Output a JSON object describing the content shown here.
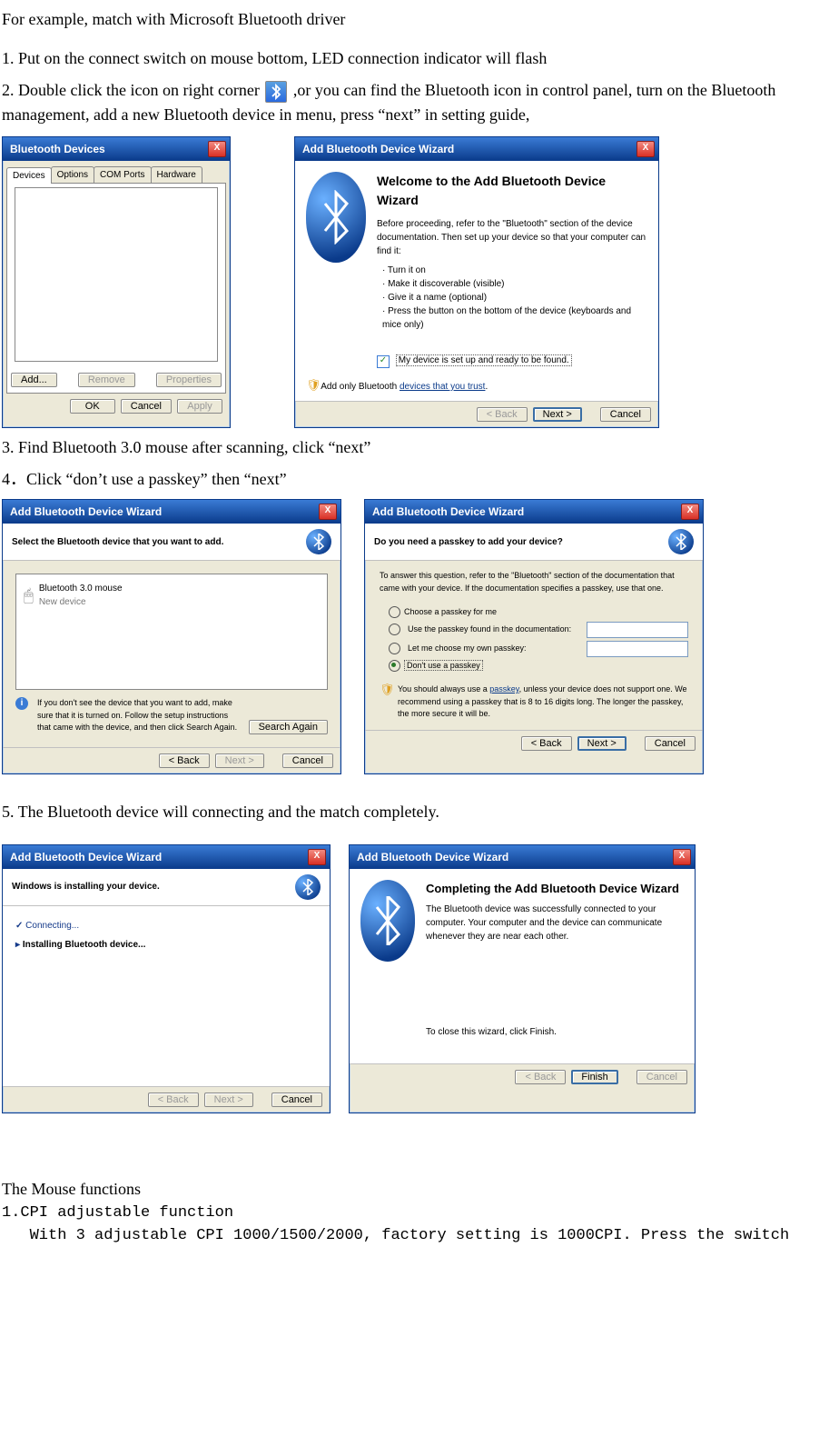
{
  "intro": "For example, match with Microsoft Bluetooth driver",
  "step1": "1.    Put on the connect switch on mouse bottom, LED connection indicator will flash",
  "step2_a": "2.    Double click the icon on right corner",
  "step2_b": "  ,or you can find the Bluetooth icon in control panel, turn on the Bluetooth management,    add a new Bluetooth device in menu, press “next” in setting guide,",
  "step3": "3.    Find Bluetooth 3.0 mouse after scanning, click “next”",
  "step4": "4．Click “don’t use a passkey” then “next”",
  "step5": "5. The Bluetooth device will connecting and the match completely.",
  "mouse_func_h": "The Mouse functions",
  "cpi_h": "1.CPI adjustable function",
  "cpi_txt": "   With 3 adjustable CPI 1000/1500/2000, factory setting is 1000CPI. Press the switch",
  "bd": {
    "title": "Bluetooth Devices",
    "tabs": [
      "Devices",
      "Options",
      "COM Ports",
      "Hardware"
    ],
    "add": "Add...",
    "remove": "Remove",
    "props": "Properties",
    "ok": "OK",
    "cancel": "Cancel",
    "apply": "Apply"
  },
  "wiz1": {
    "title": "Add Bluetooth Device Wizard",
    "h": "Welcome to the Add Bluetooth Device Wizard",
    "p1": "Before proceeding, refer to the \"Bluetooth\" section of the device documentation. Then set up your device so that your computer can find it:",
    "b1": "· Turn it on",
    "b2": "· Make it discoverable (visible)",
    "b3": "· Give it a name (optional)",
    "b4": "· Press the button on the bottom of the device (keyboards and mice only)",
    "chk": "My device is set up and ready to be found.",
    "trust_a": "Add only Bluetooth ",
    "trust_b": "devices that you trust",
    "back": "< Back",
    "next": "Next >",
    "cancel": "Cancel"
  },
  "wiz2": {
    "title": "Add Bluetooth Device Wizard",
    "h": "Select the Bluetooth device that you want to add.",
    "item_name": "Bluetooth 3.0 mouse",
    "item_sub": "New device",
    "info": "If you don't see the device that you want to add, make sure that it is turned on. Follow the setup instructions that came with the device, and then click Search Again.",
    "search": "Search Again",
    "back": "< Back",
    "next": "Next >",
    "cancel": "Cancel"
  },
  "wiz3": {
    "title": "Add Bluetooth Device Wizard",
    "h": "Do you need a passkey to add your device?",
    "p": "To answer this question, refer to the \"Bluetooth\" section of the documentation that came with your device. If the documentation specifies a passkey, use that one.",
    "r1": "Choose a passkey for me",
    "r2": "Use the passkey found in the documentation:",
    "r3": "Let me choose my own passkey:",
    "r4": "Don't use a passkey",
    "warn_a": "You should always use a ",
    "warn_b": "passkey",
    "warn_c": ", unless your device does not support one. We recommend using a passkey that is 8 to 16 digits long. The longer the passkey, the more secure it will be.",
    "back": "< Back",
    "next": "Next >",
    "cancel": "Cancel"
  },
  "wiz4": {
    "title": "Add Bluetooth Device Wizard",
    "h": "Windows is installing your device.",
    "l1": "Connecting...",
    "l2": "Installing Bluetooth device...",
    "back": "< Back",
    "next": "Next >",
    "cancel": "Cancel"
  },
  "wiz5": {
    "title": "Add Bluetooth Device Wizard",
    "h": "Completing the Add Bluetooth Device Wizard",
    "p": "The Bluetooth device was successfully connected to your computer. Your computer and the device can communicate whenever they are near each other.",
    "close": "To close this wizard, click Finish.",
    "back": "< Back",
    "finish": "Finish",
    "cancel": "Cancel"
  }
}
